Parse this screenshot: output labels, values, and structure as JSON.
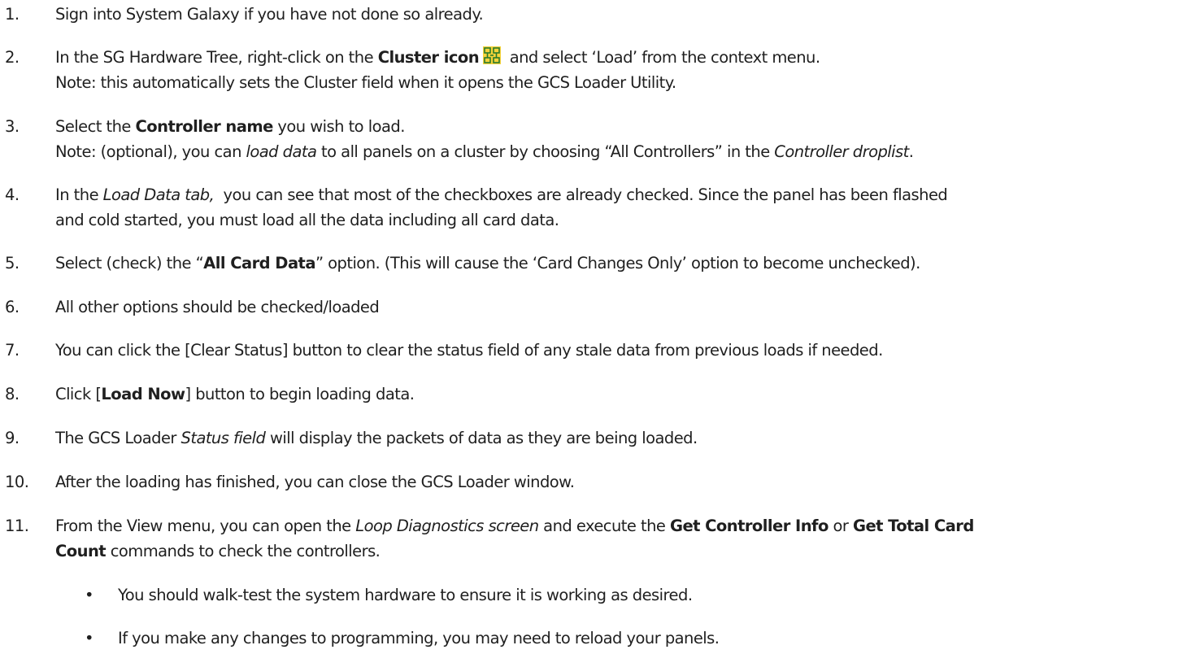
{
  "steps": [
    {
      "num": "1.",
      "lines": [
        [
          "Sign into System Galaxy if you have not done so already."
        ]
      ]
    },
    {
      "num": "2.",
      "lines": [
        [
          "In the SG Hardware Tree, right-click on the ",
          "Cluster icon",
          " and select ‘Load’ from the context menu."
        ],
        [
          "Note: this automatically sets the Cluster field when it opens the GCS Loader Utility."
        ]
      ]
    },
    {
      "num": "3.",
      "lines": [
        [
          "Select the ",
          "Controller name",
          " you wish to load."
        ],
        [
          "Note: (optional), you can ",
          "load data",
          " to all panels on a cluster by choosing “All Controllers” in the ",
          "Controller droplist",
          "."
        ]
      ]
    },
    {
      "num": "4.",
      "lines": [
        [
          "In the ",
          "Load Data tab,",
          "  you can see that most of the checkboxes are already checked. Since the panel has been flashed"
        ],
        [
          "and cold started, you must load all the data including all card data."
        ]
      ]
    },
    {
      "num": "5.",
      "lines": [
        [
          "Select (check) the “",
          "All Card Data",
          "” option. (This will cause the ‘Card Changes Only’ option to become unchecked)."
        ]
      ]
    },
    {
      "num": "6.",
      "lines": [
        [
          "All other options should be checked/loaded"
        ]
      ]
    },
    {
      "num": "7.",
      "lines": [
        [
          "You can click the [Clear Status] button to clear the status field of any stale data from previous loads if needed."
        ]
      ]
    },
    {
      "num": "8.",
      "lines": [
        [
          "Click [",
          "Load Now",
          "] button to begin loading data."
        ]
      ]
    },
    {
      "num": "9.",
      "lines": [
        [
          "The GCS Loader ",
          "Status field",
          " will display the packets of data as they are being loaded."
        ]
      ]
    },
    {
      "num": "10.",
      "lines": [
        [
          "After the loading has finished, you can close the GCS Loader window."
        ]
      ]
    },
    {
      "num": "11.",
      "lines": [
        [
          "From the View menu, you can open the ",
          "Loop Diagnostics screen",
          " and execute the ",
          "Get Controller Info",
          " or ",
          "Get Total Card"
        ],
        [
          "Count",
          " commands to check the controllers."
        ]
      ]
    }
  ],
  "bullets": [
    "You should walk-test the system hardware to ensure it is working as desired.",
    "If you make any changes to programming, you may need to reload your panels."
  ],
  "bullet_glyph": "•",
  "icons": {
    "cluster": "cluster-icon"
  },
  "colors": {
    "text": "#1f1f1f",
    "icon_fill": "#f5d23a",
    "icon_line": "#2a7a2a"
  }
}
